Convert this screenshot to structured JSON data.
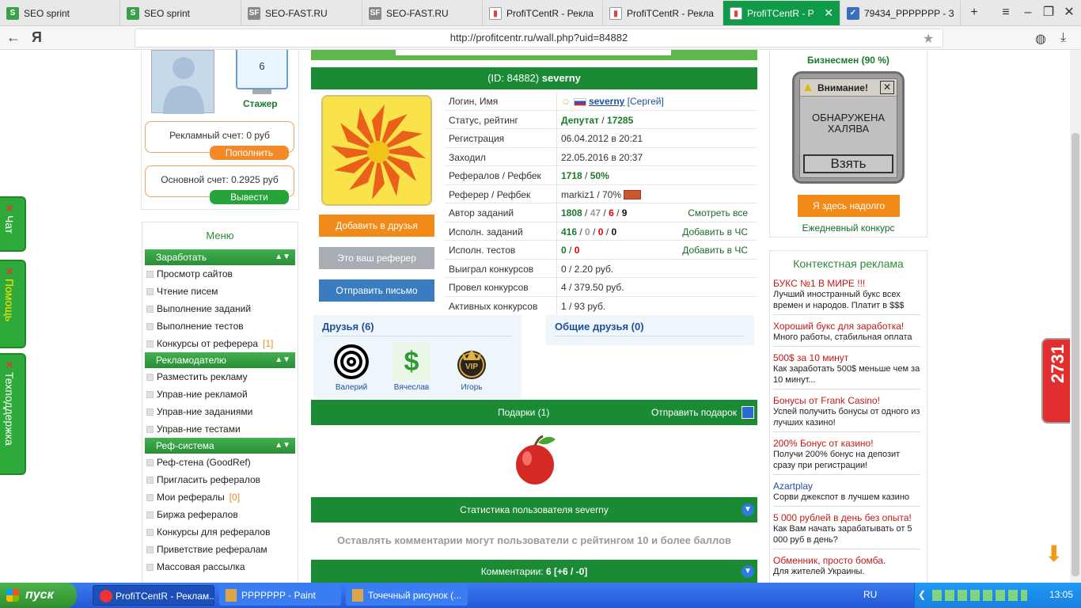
{
  "tabs": [
    {
      "label": "SEO sprint",
      "icon": "seo-sprint-favicon"
    },
    {
      "label": "SEO sprint",
      "icon": "seo-sprint-favicon"
    },
    {
      "label": "SEO-FAST.RU",
      "icon": "seo-fast-favicon"
    },
    {
      "label": "SEO-FAST.RU",
      "icon": "seo-fast-favicon"
    },
    {
      "label": "ProfiTCentR - Рекла",
      "icon": "chart-favicon"
    },
    {
      "label": "ProfiTCentR - Рекла",
      "icon": "chart-favicon"
    },
    {
      "label": "ProfiTCentR - Р",
      "icon": "chart-favicon",
      "active": true
    },
    {
      "label": "79434_PPPPPPP - З",
      "icon": "vk-favicon"
    }
  ],
  "address": {
    "url": "http://profitcentr.ru/wall.php?uid=84882",
    "yandex_letter": "Я"
  },
  "sidebar_tabs": {
    "chat": "Чат",
    "help": "Помощь",
    "support": "Техподдержка"
  },
  "left": {
    "level_badge": "6",
    "level_name": "Стажер",
    "ad_account": "Рекламный счет: 0 руб",
    "topup_btn": "Пополнить",
    "main_account": "Основной счет: 0.2925 руб",
    "withdraw_btn": "Вывести",
    "menu_title": "Меню",
    "sections": [
      {
        "title": "Заработать",
        "items": [
          {
            "label": "Просмотр сайтов"
          },
          {
            "label": "Чтение писем"
          },
          {
            "label": "Выполнение заданий"
          },
          {
            "label": "Выполнение тестов"
          },
          {
            "label": "Конкурсы от реферера",
            "count": "[1]"
          }
        ]
      },
      {
        "title": "Рекламодателю",
        "items": [
          {
            "label": "Разместить рекламу"
          },
          {
            "label": "Управ-ние рекламой"
          },
          {
            "label": "Управ-ние заданиями"
          },
          {
            "label": "Управ-ние тестами"
          }
        ]
      },
      {
        "title": "Реф-система",
        "items": [
          {
            "label": "Реф-стена (GoodRef)"
          },
          {
            "label": "Пригласить рефералов"
          },
          {
            "label": "Мои рефералы",
            "count": "[0]"
          },
          {
            "label": "Биржа рефералов"
          },
          {
            "label": "Конкурсы для рефералов"
          },
          {
            "label": "Приветствие рефералам"
          },
          {
            "label": "Массовая рассылка"
          }
        ]
      }
    ]
  },
  "profile": {
    "header_id": "(ID: 84882)",
    "header_name": "severny",
    "btn_add_friend": "Добавить в друзья",
    "btn_your_referrer": "Это ваш реферер",
    "btn_send_letter": "Отправить письмо",
    "rows": [
      {
        "k": "Логин, Имя",
        "login": "severny",
        "name": "[Сергей]"
      },
      {
        "k": "Статус, рейтинг",
        "status": "Депутат",
        "rating": "17285"
      },
      {
        "k": "Регистрация",
        "v": "06.04.2012 в 20:21"
      },
      {
        "k": "Заходил",
        "v": "22.05.2016 в 20:37"
      },
      {
        "k": "Рефералов / Рефбек",
        "a": "1718",
        "b": "50%"
      },
      {
        "k": "Реферер / Рефбек",
        "v": "markiz1 / 70%"
      },
      {
        "k": "Автор заданий",
        "n1": "1808",
        "n2": "47",
        "n3": "6",
        "n4": "9",
        "link": "Смотреть все"
      },
      {
        "k": "Исполн. заданий",
        "n1": "416",
        "n2": "0",
        "n3": "0",
        "n4": "0",
        "link": "Добавить в ЧС"
      },
      {
        "k": "Исполн. тестов",
        "n1": "0",
        "n3": "0",
        "link": "Добавить в ЧС"
      },
      {
        "k": "Выиграл конкурсов",
        "v": "0 / 2.20 руб."
      },
      {
        "k": "Провел конкурсов",
        "v": "4 / 379.50 руб."
      },
      {
        "k": "Активных конкурсов",
        "v": "1 / 93 руб."
      }
    ],
    "friends_title": "Друзья (6)",
    "friends": [
      {
        "name": "Валерий"
      },
      {
        "name": "Вячеслав"
      },
      {
        "name": "Игорь"
      }
    ],
    "common_title": "Общие друзья (0)",
    "gifts_title": "Подарки (1)",
    "send_gift": "Отправить подарок",
    "stats_title": "Статистика пользователя severny",
    "comment_note": "Оставлять комментарии могут пользователи с рейтингом 10 и более баллов",
    "comments_label": "Комментарии:",
    "comments_value": "6 [+6 / -0]"
  },
  "right": {
    "top_partial": "Бизнесмен (90 %)",
    "popup_title": "Внимание!",
    "popup_text1": "ОБНАРУЖЕНА",
    "popup_text2": "ХАЛЯВА",
    "popup_btn": "Взять",
    "here_btn": "Я здесь надолго",
    "daily": "Ежедневный конкурс",
    "ctx_title": "Контекстная реклама",
    "ads": [
      {
        "h": "БУКС №1 В МИРЕ !!!",
        "d": "Лучший иностранный букс всех времен и народов. Платит в $$$"
      },
      {
        "h": "Хороший букс для заработка!",
        "d": "Много работы, стабильная оплата"
      },
      {
        "h": "500$ за 10 минут",
        "d": "Как заработать 500$ меньше чем за 10 минут..."
      },
      {
        "h": "Бонусы от Frank Casino!",
        "d": "Успей получить бонусы от одного из лучших казино!"
      },
      {
        "h": "200% Бонус от казино!",
        "d": "Получи 200% бонус на депозит сразу при регистрации!"
      },
      {
        "h": "Azartplay",
        "d": "Сорви джекспот в лучшем казино",
        "blue": true
      },
      {
        "h": "5 000 рублей в день без опыта!",
        "d": "Как Вам начать зарабатывать от 5 000 руб в день?"
      },
      {
        "h": "Обменник, просто бомба.",
        "d": "Для жителей Украины."
      }
    ]
  },
  "counter_badge": "2731",
  "taskbar": {
    "start": "пуск",
    "items": [
      "ProfiTCentR - Реклам...",
      "PPPPPPP - Paint",
      "Точечный рисунок (..."
    ],
    "lang": "RU",
    "clock": "13:05"
  },
  "colors": {
    "green": "#1a8a35",
    "orange": "#f28a2a",
    "accent_tab": "#0f9b4a"
  }
}
